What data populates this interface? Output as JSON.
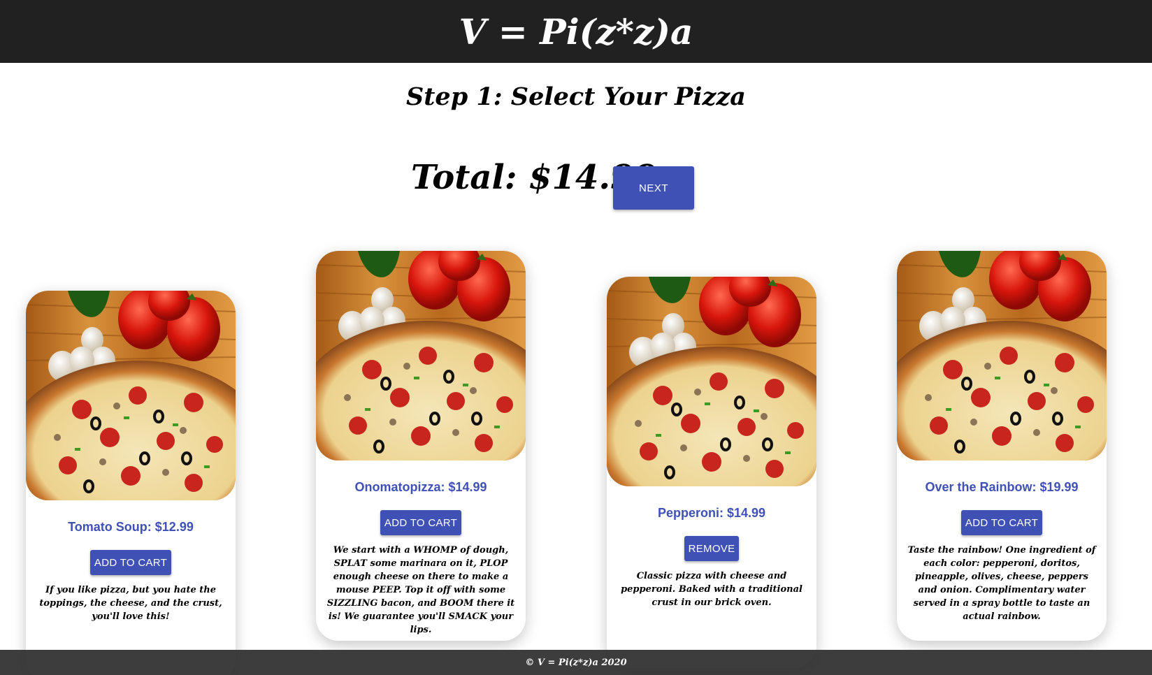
{
  "header": {
    "title": "V = Pi(z*z)a"
  },
  "step_title": "Step 1: Select Your Pizza",
  "total": {
    "label": "Total: $14.99"
  },
  "next_button": "NEXT",
  "cards": [
    {
      "title": "Tomato Soup: $12.99",
      "button": "ADD TO CART",
      "description": "If you like pizza, but you hate the toppings, the cheese, and the crust, you'll love this!"
    },
    {
      "title": "Onomatopizza: $14.99",
      "button": "ADD TO CART",
      "description": "We start with a WHOMP of dough, SPLAT some marinara on it, PLOP enough cheese on there to make a mouse PEEP. Top it off with some SIZZLING bacon, and BOOM there it is! We guarantee you'll SMACK your lips."
    },
    {
      "title": "Pepperoni: $14.99",
      "button": "REMOVE",
      "description": "Classic pizza with cheese and pepperoni. Baked with a traditional crust in our brick oven."
    },
    {
      "title": "Over the Rainbow: $19.99",
      "button": "ADD TO CART",
      "description": "Taste the rainbow! One ingredient of each color: pepperoni, doritos, pineapple, olives, cheese, peppers and onion. Complimentary water served in a spray bottle to taste an actual rainbow."
    }
  ],
  "footer": {
    "text": "© V = Pi(z*z)a 2020"
  },
  "colors": {
    "accent": "#3f51b5",
    "header_bg": "#212121"
  },
  "icons": {
    "card_image": "pizza-photo"
  }
}
